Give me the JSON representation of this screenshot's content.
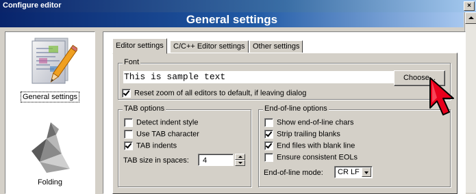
{
  "window": {
    "title": "Configure editor",
    "close_symbol": "×"
  },
  "header": {
    "title": "General settings"
  },
  "sidebar": {
    "items": [
      {
        "label": "General settings",
        "icon": "document-pencil-icon",
        "selected": true
      },
      {
        "label": "Folding",
        "icon": "origami-bird-icon",
        "selected": false
      }
    ]
  },
  "tabs": [
    {
      "label": "Editor settings",
      "active": true
    },
    {
      "label": "C/C++ Editor settings",
      "active": false
    },
    {
      "label": "Other settings",
      "active": false
    }
  ],
  "font_group": {
    "title": "Font",
    "sample_text": "This is sample text",
    "choose_label": "Choose...",
    "reset_zoom_label": "Reset zoom of all editors to default, if leaving dialog",
    "reset_zoom_checked": true
  },
  "tab_options": {
    "title": "TAB options",
    "items": [
      {
        "label": "Detect indent style",
        "checked": false
      },
      {
        "label": "Use TAB character",
        "checked": false
      },
      {
        "label": "TAB indents",
        "checked": true
      }
    ],
    "size_label": "TAB size in spaces:",
    "size_value": "4"
  },
  "eol_options": {
    "title": "End-of-line options",
    "items": [
      {
        "label": "Show end-of-line chars",
        "checked": false
      },
      {
        "label": "Strip trailing blanks",
        "checked": true
      },
      {
        "label": "End files with blank line",
        "checked": true
      },
      {
        "label": "Ensure consistent EOLs",
        "checked": false
      }
    ],
    "mode_label": "End-of-line mode:",
    "mode_value": "CR LF"
  },
  "colors": {
    "cursor_red": "#e8001c",
    "header_blue": "#08246b"
  }
}
